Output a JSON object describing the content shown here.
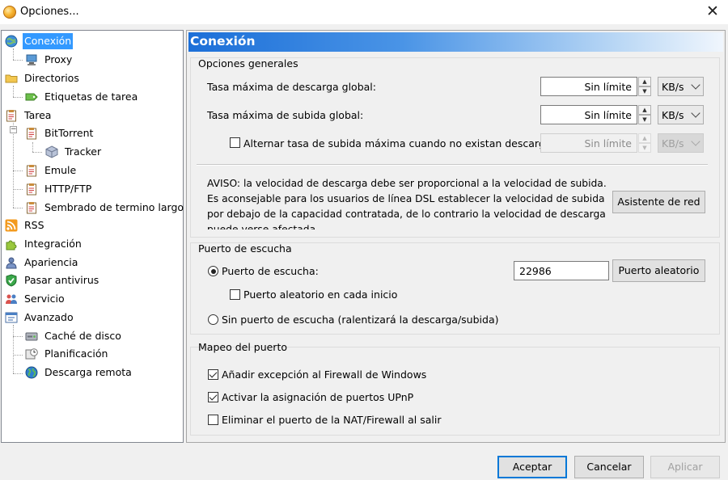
{
  "window": {
    "title": "Opciones...",
    "close_glyph": "✕"
  },
  "tree": {
    "items": [
      {
        "label": "Conexión",
        "icon": "globe-network-icon"
      },
      {
        "label": "Proxy",
        "icon": "computer-network-icon"
      },
      {
        "label": "Directorios",
        "icon": "folder-icon"
      },
      {
        "label": "Etiquetas de tarea",
        "icon": "tag-icon"
      },
      {
        "label": "Tarea",
        "icon": "clipboard-icon"
      },
      {
        "label": "BitTorrent",
        "icon": "clipboard-icon"
      },
      {
        "label": "Tracker",
        "icon": "cube-icon"
      },
      {
        "label": "Emule",
        "icon": "clipboard-icon"
      },
      {
        "label": "HTTP/FTP",
        "icon": "clipboard-icon"
      },
      {
        "label": "Sembrado de termino largo",
        "icon": "clipboard-icon"
      },
      {
        "label": "RSS",
        "icon": "rss-icon"
      },
      {
        "label": "Integración",
        "icon": "puzzle-icon"
      },
      {
        "label": "Apariencia",
        "icon": "person-icon"
      },
      {
        "label": "Pasar antivirus",
        "icon": "shield-icon"
      },
      {
        "label": "Servicio",
        "icon": "people-icon"
      },
      {
        "label": "Avanzado",
        "icon": "settings-window-icon"
      },
      {
        "label": "Caché de disco",
        "icon": "disk-icon"
      },
      {
        "label": "Planificación",
        "icon": "clock-icon"
      },
      {
        "label": "Descarga remota",
        "icon": "earth-icon"
      }
    ],
    "expander_glyph": "−"
  },
  "panel": {
    "header": "Conexión",
    "general": {
      "title": "Opciones generales",
      "download_label": "Tasa máxima de descarga global:",
      "download_value": "Sin límite",
      "download_unit": "KB/s",
      "upload_label": "Tasa máxima de subida global:",
      "upload_value": "Sin límite",
      "upload_unit": "KB/s",
      "alt_label": "Alternar tasa de subida máxima cuando no existan descargas",
      "alt_value": "Sin límite",
      "alt_unit": "KB/s",
      "alt_checked": false,
      "notice": "AVISO: la velocidad de descarga debe ser proporcional a la velocidad de subida. Es aconsejable para los usuarios de línea DSL establecer la velocidad de subida por debajo de la capacidad contratada, de lo contrario la velocidad de descarga puede verse afectada",
      "wizard_button": "Asistente de red",
      "spin_up": "▲",
      "spin_down": "▼"
    },
    "listen": {
      "title": "Puerto de escucha",
      "port_radio_label": "Puerto de escucha:",
      "port_value": "22986",
      "random_button": "Puerto aleatorio",
      "random_each_start_label": "Puerto aleatorio en cada inicio",
      "random_each_start_checked": false,
      "no_port_label": "Sin puerto de escucha (ralentizará la descarga/subida)",
      "selected": "port"
    },
    "mapping": {
      "title": "Mapeo del puerto",
      "firewall_label": "Añadir excepción al Firewall de Windows",
      "firewall_checked": true,
      "upnp_label": "Activar la asignación de puertos UPnP",
      "upnp_checked": true,
      "nat_label": "Eliminar el puerto de la NAT/Firewall al salir",
      "nat_checked": false
    }
  },
  "buttons": {
    "accept": "Aceptar",
    "cancel": "Cancelar",
    "apply": "Aplicar"
  },
  "colors": {
    "selection": "#3399ff",
    "header_gradient_start": "#1c6fd8",
    "default_button_border": "#0078d7"
  }
}
